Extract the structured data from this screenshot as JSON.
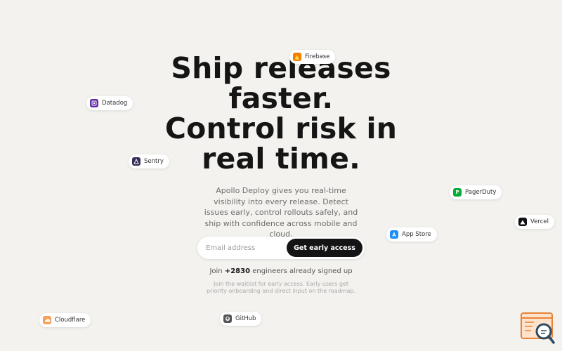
{
  "hero": {
    "title_lines": [
      "Ship releases",
      "faster.",
      "Control risk in",
      "real time."
    ],
    "subtitle": "Apollo Deploy gives you real-time visibility into every release. Detect issues early, control rollouts safely, and ship with confidence across mobile and cloud."
  },
  "signup": {
    "email_placeholder": "Email address",
    "cta_label": "Get early access"
  },
  "social_proof": {
    "prefix": "Join",
    "count": "+2830",
    "suffix": "engineers already signed up"
  },
  "note": "Join the waitlist for early access. Early users get priority onboarding and direct input on the roadmap.",
  "integrations": [
    {
      "label": "Firebase",
      "icon": "firebase-icon",
      "color": "#f57c00"
    },
    {
      "label": "Datadog",
      "icon": "datadog-icon",
      "color": "#632ca6"
    },
    {
      "label": "Sentry",
      "icon": "sentry-icon",
      "color": "#362d59"
    },
    {
      "label": "PagerDuty",
      "icon": "pagerduty-icon",
      "color": "#06ac38"
    },
    {
      "label": "Vercel",
      "icon": "vercel-icon",
      "color": "#111111"
    },
    {
      "label": "App Store",
      "icon": "app-store-icon",
      "color": "#1c8ef9"
    },
    {
      "label": "Cloudflare",
      "icon": "cloudflare-icon",
      "color": "#f38020"
    },
    {
      "label": "GitHub",
      "icon": "github-icon",
      "color": "#333333"
    }
  ],
  "colors": {
    "background": "#f3f2ef",
    "cta_background": "#141414",
    "widget_accent": "#e8833a"
  }
}
